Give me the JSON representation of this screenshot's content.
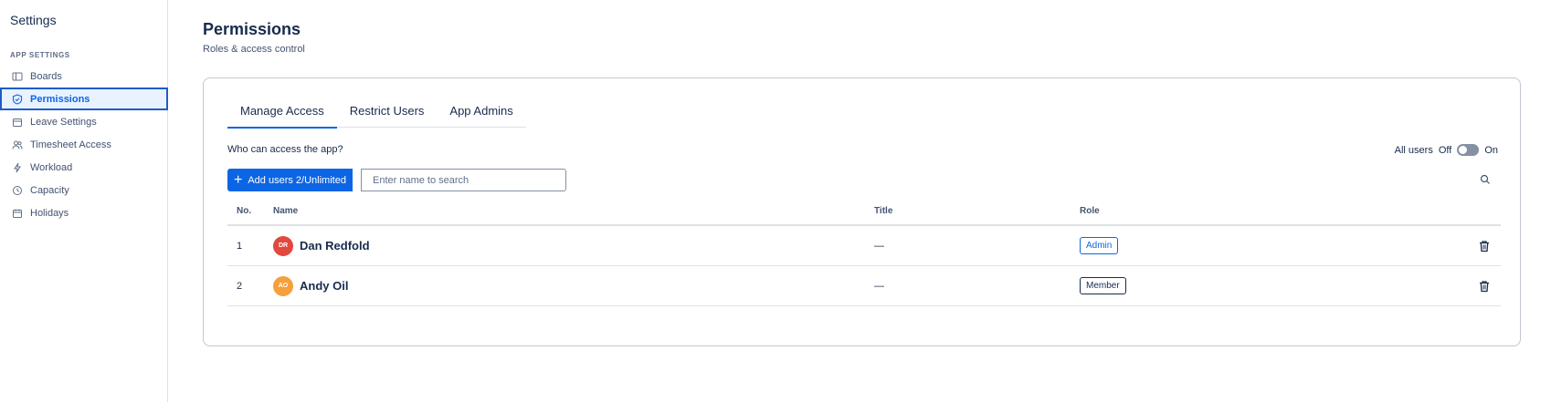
{
  "sidebar": {
    "title": "Settings",
    "section": "APP SETTINGS",
    "items": [
      {
        "label": "Boards",
        "icon": "board-icon"
      },
      {
        "label": "Permissions",
        "icon": "shield-icon",
        "active": true
      },
      {
        "label": "Leave Settings",
        "icon": "calendar-icon"
      },
      {
        "label": "Timesheet Access",
        "icon": "users-icon"
      },
      {
        "label": "Workload",
        "icon": "lightning-icon"
      },
      {
        "label": "Capacity",
        "icon": "clock-icon"
      },
      {
        "label": "Holidays",
        "icon": "calendar-icon"
      }
    ]
  },
  "page": {
    "title": "Permissions",
    "subtitle": "Roles & access control"
  },
  "tabs": [
    {
      "label": "Manage Access",
      "active": true
    },
    {
      "label": "Restrict Users"
    },
    {
      "label": "App Admins"
    }
  ],
  "access": {
    "question": "Who can access the app?",
    "all_users_label": "All users",
    "off_label": "Off",
    "on_label": "On",
    "all_users_enabled": false
  },
  "toolbar": {
    "add_button_label": "Add users 2/Unlimited",
    "search_placeholder": "Enter name to search"
  },
  "table": {
    "headers": {
      "no": "No.",
      "name": "Name",
      "title": "Title",
      "role": "Role"
    },
    "rows": [
      {
        "no": "1",
        "initials": "DR",
        "name": "Dan Redfold",
        "title": "—",
        "role": "Admin",
        "avatar_color": "#e2483d"
      },
      {
        "no": "2",
        "initials": "AO",
        "name": "Andy Oil",
        "title": "—",
        "role": "Member",
        "avatar_color": "#f5a03c"
      }
    ]
  },
  "colors": {
    "accent": "#0c66e4",
    "active_nav_bg": "#e9f2ff"
  }
}
